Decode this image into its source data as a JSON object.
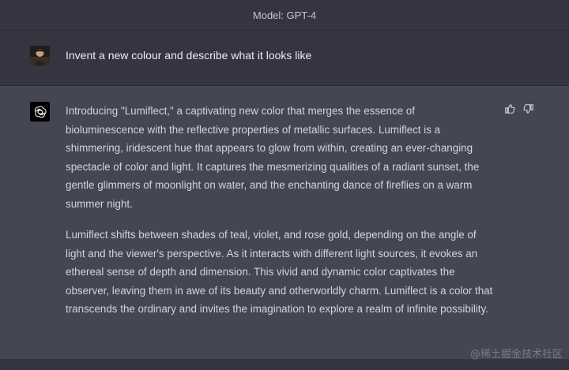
{
  "header": {
    "model_label": "Model: GPT-4"
  },
  "conversation": {
    "user_message": "Invent a new colour and describe what it looks like",
    "assistant_paragraphs": [
      "Introducing \"Lumiflect,\" a captivating new color that merges the essence of bioluminescence with the reflective properties of metallic surfaces. Lumiflect is a shimmering, iridescent hue that appears to glow from within, creating an ever-changing spectacle of color and light. It captures the mesmerizing qualities of a radiant sunset, the gentle glimmers of moonlight on water, and the enchanting dance of fireflies on a warm summer night.",
      "Lumiflect shifts between shades of teal, violet, and rose gold, depending on the angle of light and the viewer's perspective. As it interacts with different light sources, it evokes an ethereal sense of depth and dimension. This vivid and dynamic color captivates the observer, leaving them in awe of its beauty and otherworldly charm. Lumiflect is a color that transcends the ordinary and invites the imagination to explore a realm of infinite possibility."
    ]
  },
  "icons": {
    "user_avatar": "user-avatar-photo",
    "assistant_avatar": "openai-logo-icon",
    "thumbs_up": "thumbs-up-icon",
    "thumbs_down": "thumbs-down-icon"
  },
  "watermark": "@稀土掘金技术社区",
  "colors": {
    "page_bg": "#444654",
    "header_bg": "#343541",
    "text_primary": "#ececf1",
    "text_answer": "#d1d5db"
  }
}
